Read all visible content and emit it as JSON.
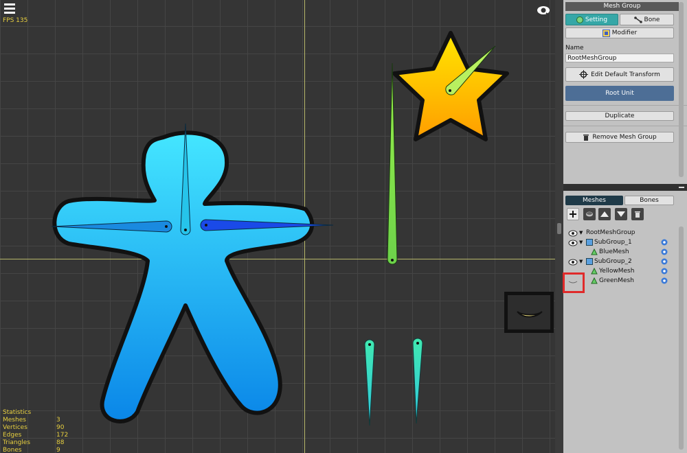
{
  "viewport": {
    "fps": "FPS 135",
    "stats": {
      "title": "Statistics",
      "rows": [
        {
          "label": "Meshes",
          "value": "3"
        },
        {
          "label": "Vertices",
          "value": "90"
        },
        {
          "label": "Edges",
          "value": "172"
        },
        {
          "label": "Triangles",
          "value": "88"
        },
        {
          "label": "Bones",
          "value": "9"
        }
      ]
    }
  },
  "panel": {
    "header": "Mesh Group",
    "tabs": {
      "setting": "Setting",
      "bone": "Bone"
    },
    "modifier": "Modifier",
    "name_label": "Name",
    "name_value": "RootMeshGroup",
    "edit_default_transform": "Edit Default Transform",
    "root_unit": "Root Unit",
    "duplicate": "Duplicate",
    "remove_mesh_group": "Remove Mesh Group",
    "list_tabs": {
      "meshes": "Meshes",
      "bones": "Bones"
    },
    "tree": [
      {
        "name": "RootMeshGroup"
      },
      {
        "name": "SubGroup_1"
      },
      {
        "name": "BlueMesh"
      },
      {
        "name": "SubGroup_2"
      },
      {
        "name": "YellowMesh"
      },
      {
        "name": "GreenMesh"
      }
    ]
  },
  "colors": {
    "accent_teal": "#36a7a7",
    "root_unit_blue": "#4d6e96",
    "highlight_red": "#e02a2a",
    "stats_yellow": "#e8d040"
  }
}
